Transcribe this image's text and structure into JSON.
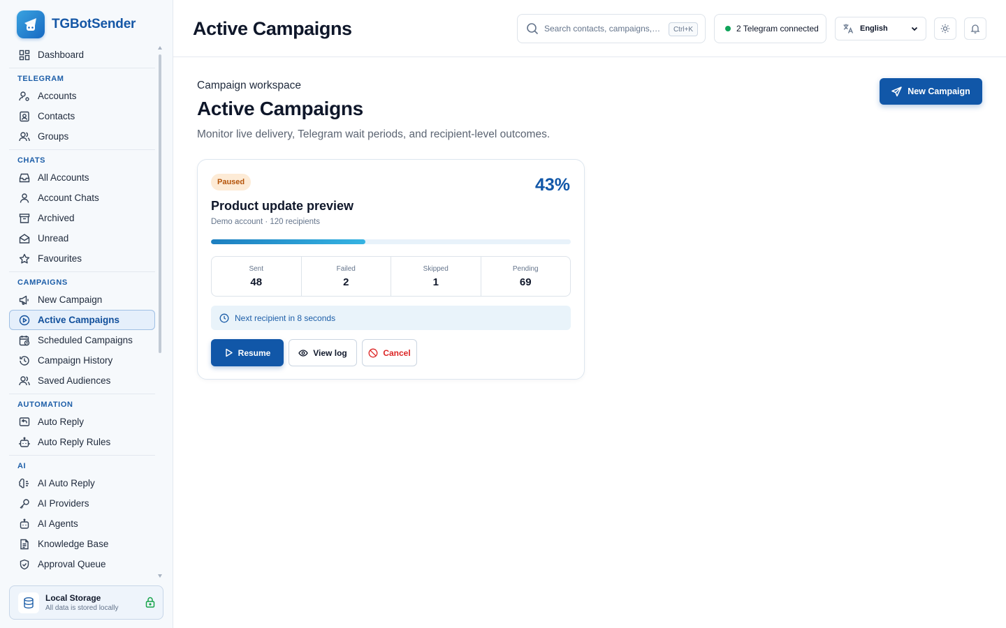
{
  "app": {
    "name": "TGBotSender"
  },
  "sidebar": {
    "dashboard": "Dashboard",
    "sections": [
      {
        "title": "TELEGRAM",
        "items": [
          "Accounts",
          "Contacts",
          "Groups"
        ]
      },
      {
        "title": "CHATS",
        "items": [
          "All Accounts",
          "Account Chats",
          "Archived",
          "Unread",
          "Favourites"
        ]
      },
      {
        "title": "CAMPAIGNS",
        "items": [
          "New Campaign",
          "Active Campaigns",
          "Scheduled Campaigns",
          "Campaign History",
          "Saved Audiences"
        ]
      },
      {
        "title": "AUTOMATION",
        "items": [
          "Auto Reply",
          "Auto Reply Rules"
        ]
      },
      {
        "title": "AI",
        "items": [
          "AI Auto Reply",
          "AI Providers",
          "AI Agents",
          "Knowledge Base",
          "Approval Queue"
        ]
      }
    ],
    "active_item": "Active Campaigns",
    "storage": {
      "title": "Local Storage",
      "subtitle": "All data is stored locally"
    }
  },
  "topbar": {
    "title": "Active Campaigns",
    "search_placeholder": "Search contacts, campaigns, t...",
    "search_shortcut": "Ctrl+K",
    "connection_status": "2 Telegram connected",
    "language": "English"
  },
  "main": {
    "eyebrow": "Campaign workspace",
    "title": "Active Campaigns",
    "description": "Monitor live delivery, Telegram wait periods, and recipient-level outcomes.",
    "new_campaign_label": "New Campaign"
  },
  "campaign": {
    "status": "Paused",
    "progress_label": "43%",
    "progress": 0.43,
    "name": "Product update preview",
    "meta": "Demo account · 120 recipients",
    "stats": [
      {
        "label": "Sent",
        "value": "48"
      },
      {
        "label": "Failed",
        "value": "2"
      },
      {
        "label": "Skipped",
        "value": "1"
      },
      {
        "label": "Pending",
        "value": "69"
      }
    ],
    "next_text": "Next recipient in 8 seconds",
    "actions": {
      "resume": "Resume",
      "view_log": "View log",
      "cancel": "Cancel"
    }
  },
  "colors": {
    "primary": "#1157a8",
    "brand": "#1557a6",
    "paused_bg": "#fdebd6",
    "paused_text": "#b45309",
    "connected_dot": "#10a35a",
    "cancel": "#dc2626"
  }
}
